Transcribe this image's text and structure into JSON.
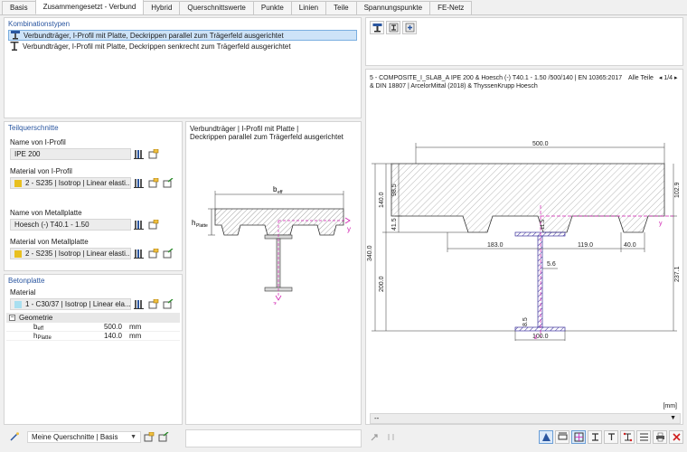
{
  "tabs": [
    {
      "label": "Basis",
      "active": false
    },
    {
      "label": "Zusammengesetzt - Verbund",
      "active": true
    },
    {
      "label": "Hybrid",
      "active": false
    },
    {
      "label": "Querschnittswerte",
      "active": false
    },
    {
      "label": "Punkte",
      "active": false
    },
    {
      "label": "Linien",
      "active": false
    },
    {
      "label": "Teile",
      "active": false
    },
    {
      "label": "Spannungspunkte",
      "active": false
    },
    {
      "label": "FE-Netz",
      "active": false
    }
  ],
  "kombi": {
    "title": "Kombinationstypen",
    "items": [
      "Verbundträger, I-Profil mit Platte, Deckrippen parallel zum Trägerfeld ausgerichtet",
      "Verbundträger, I-Profil mit Platte, Deckrippen senkrecht zum Trägerfeld ausgerichtet"
    ]
  },
  "teil": {
    "title": "Teilquerschnitte",
    "name_iprofil_label": "Name von I-Profil",
    "name_iprofil_value": "IPE 200",
    "mat_iprofil_label": "Material von I-Profil",
    "mat_iprofil_value": "2 - S235 | Isotrop | Linear elasti...",
    "name_blech_label": "Name von Metallplatte",
    "name_blech_value": "Hoesch (-) T40.1 - 1.50",
    "mat_blech_label": "Material von Metallplatte",
    "mat_blech_value": "2 - S235 | Isotrop | Linear elasti...",
    "steel_color": "#e8c020"
  },
  "schema": {
    "caption_line1": "Verbundträger | I-Profil mit Platte |",
    "caption_line2": "Deckrippen parallel zum Trägerfeld ausgerichtet",
    "b_label": "b",
    "b_sub": "eff",
    "h_label": "h",
    "h_sub": "Platte",
    "y_label": "y",
    "z_label": "z"
  },
  "beton": {
    "title": "Betonplatte",
    "mat_label": "Material",
    "mat_value": "1 - C30/37 | Isotrop | Linear ela...",
    "concrete_color": "#a8dff0",
    "geo_title": "Geometrie",
    "rows": [
      {
        "name": "b",
        "sub": "eff",
        "value": "500.0",
        "unit": "mm"
      },
      {
        "name": "h",
        "sub": "Platte",
        "value": "140.0",
        "unit": "mm"
      }
    ]
  },
  "footer_left": {
    "select_value": "Meine Querschnitte | Basis"
  },
  "drawing": {
    "header_line1": "5 - COMPOSITE_I_SLAB_A IPE 200 & Hoesch (-) T40.1 - 1.50 /500/140 | EN 10365:2017",
    "header_line2": "& DIN 18807 | ArcelorMittal (2018) & ThyssenKrupp Hoesch",
    "parts_label": "Alle Teile",
    "page": "1/4",
    "unit": "[mm]",
    "dim_500": "500.0",
    "dim_140": "140.0",
    "dim_98": "98.5",
    "dim_41": "41.5",
    "dim_340": "340.0",
    "dim_200": "200.0",
    "dim_102": "102.9",
    "dim_237": "237.1",
    "dim_183": "183.0",
    "dim_119": "119.0",
    "dim_40": "40.0",
    "dim_115": "11.5",
    "dim_56": "5.6",
    "dim_85": "8.5",
    "dim_100": "100.0",
    "y_label": "y",
    "z_label": "z",
    "select_value": "--"
  }
}
